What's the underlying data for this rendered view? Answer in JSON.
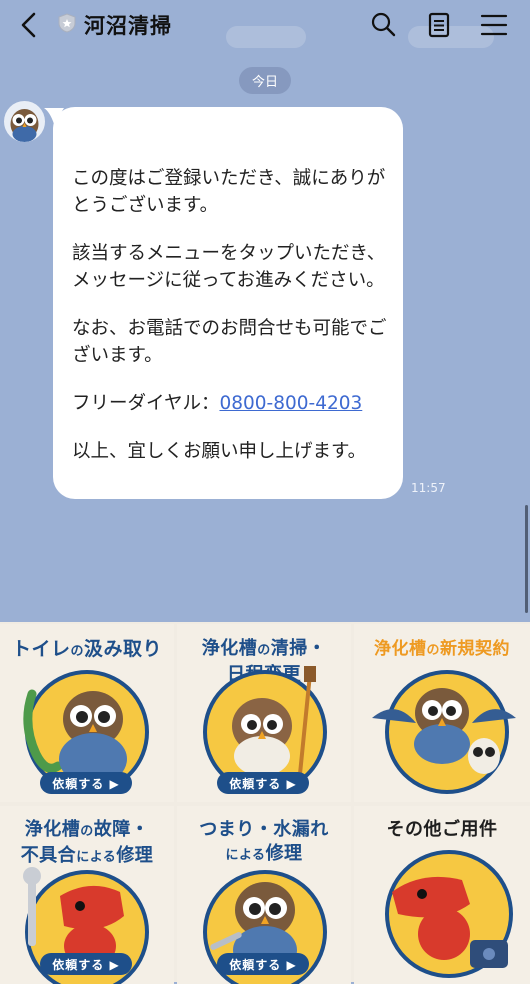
{
  "header": {
    "title": "河沼清掃",
    "icons": [
      "back-icon",
      "shield-icon",
      "search-icon",
      "notes-icon",
      "menu-icon"
    ]
  },
  "chat": {
    "date_label": "今日",
    "message": {
      "p1": "この度はご登録いただき、誠にありがとうございます。",
      "p2": "該当するメニューをタップいただき、メッセージに従ってお進みください。",
      "p3": "なお、お電話でのお問合せも可能でございます。",
      "p4_prefix": "フリーダイヤル：",
      "phone": "0800-800-4203",
      "p5": "以上、宜しくお願い申し上げます。"
    },
    "time": "11:57"
  },
  "rich_menu": {
    "tiles": [
      {
        "line1": "トイレ",
        "sm1": "の",
        "line1b": "汲み取り",
        "button": "依頼する ▶"
      },
      {
        "line1": "浄化槽",
        "sm1": "の",
        "line1b": "清掃・",
        "line2": "日程変更",
        "button": "依頼する ▶"
      },
      {
        "line1": "浄化槽",
        "sm1": "の",
        "line1b": "新規契約"
      },
      {
        "line1": "浄化槽",
        "sm1": "の",
        "line1b": "故障・",
        "line2a": "不具合",
        "sm2": "による",
        "line2b": "修理",
        "button": "依頼する ▶"
      },
      {
        "line1": "つまり・水漏れ",
        "sm2": "による",
        "line2b": "修理",
        "button": "依頼する ▶"
      },
      {
        "line1": "その他ご用件"
      }
    ]
  },
  "colors": {
    "background": "#9bb0d4",
    "menu_blue": "#1e4f8a",
    "menu_orange": "#ee9a22",
    "circle_yellow": "#f6c842",
    "link": "#3e6ad1"
  }
}
